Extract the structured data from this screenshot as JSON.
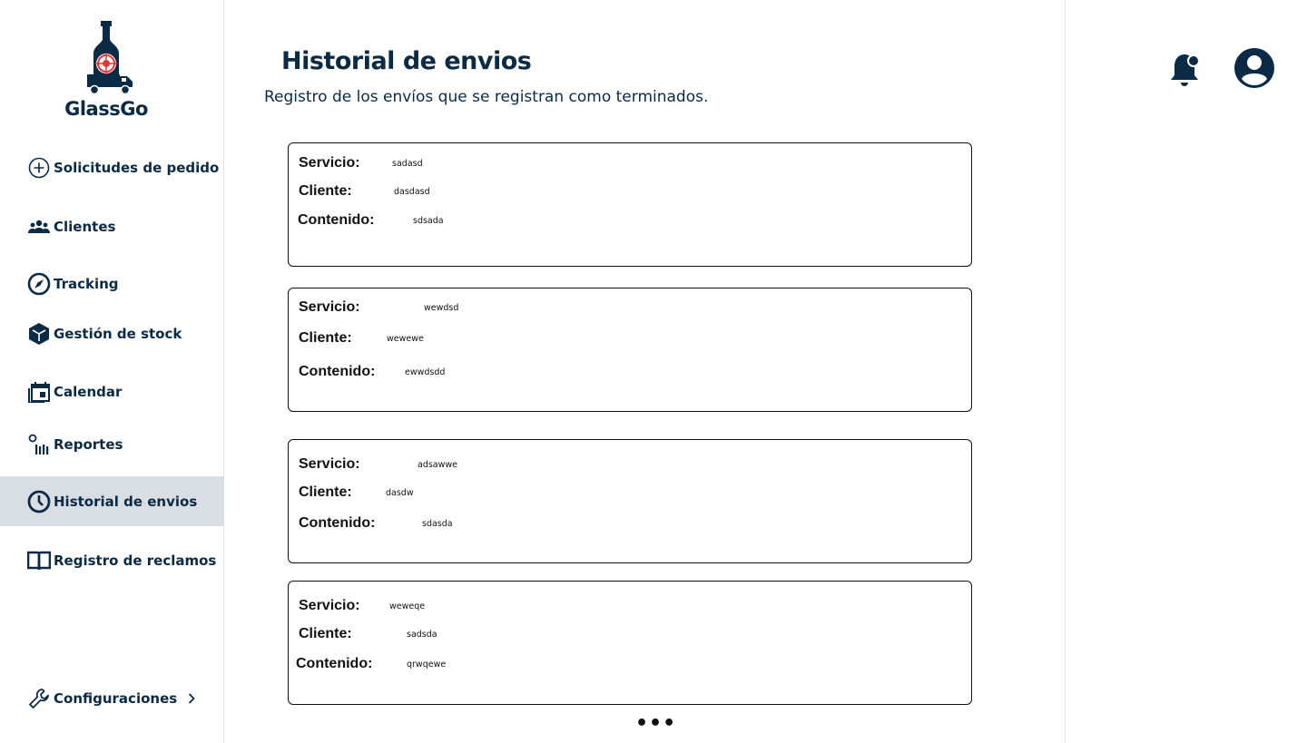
{
  "app": {
    "name": "GlassGo"
  },
  "sidebar": {
    "items": [
      {
        "label": "Solicitudes de pedido",
        "icon": "add-circle-icon"
      },
      {
        "label": "Clientes",
        "icon": "group-icon"
      },
      {
        "label": "Tracking",
        "icon": "compass-icon"
      },
      {
        "label": "Gestión de stock",
        "icon": "cube-icon"
      },
      {
        "label": "Calendar",
        "icon": "calendar-icon"
      },
      {
        "label": "Reportes",
        "icon": "chart-icon"
      },
      {
        "label": "Historial de envios",
        "icon": "clock-icon",
        "active": true
      },
      {
        "label": "Registro de reclamos",
        "icon": "book-icon"
      }
    ],
    "settings": {
      "label": "Configuraciones",
      "icon": "wrench-icon"
    }
  },
  "header": {
    "title": "Historial de envios",
    "subtitle": "Registro de los envíos que se registran como terminados."
  },
  "labels": {
    "servicio": "Servicio:",
    "cliente": "Cliente:",
    "contenido": "Contenido:"
  },
  "shipments": [
    {
      "servicio": "sadasd",
      "cliente": "dasdasd",
      "contenido": "sdsada"
    },
    {
      "servicio": "wewdsd",
      "cliente": "wewewe",
      "contenido": "ewwdsdd"
    },
    {
      "servicio": "adsawwe",
      "cliente": "dasdw",
      "contenido": "sdasda"
    },
    {
      "servicio": "weweqe",
      "cliente": "sadsda",
      "contenido": "qrwqewe"
    }
  ],
  "more_label": "•••",
  "colors": {
    "primary": "#0b2a45",
    "active_bg": "#d9dde4",
    "accent": "#e53935"
  }
}
